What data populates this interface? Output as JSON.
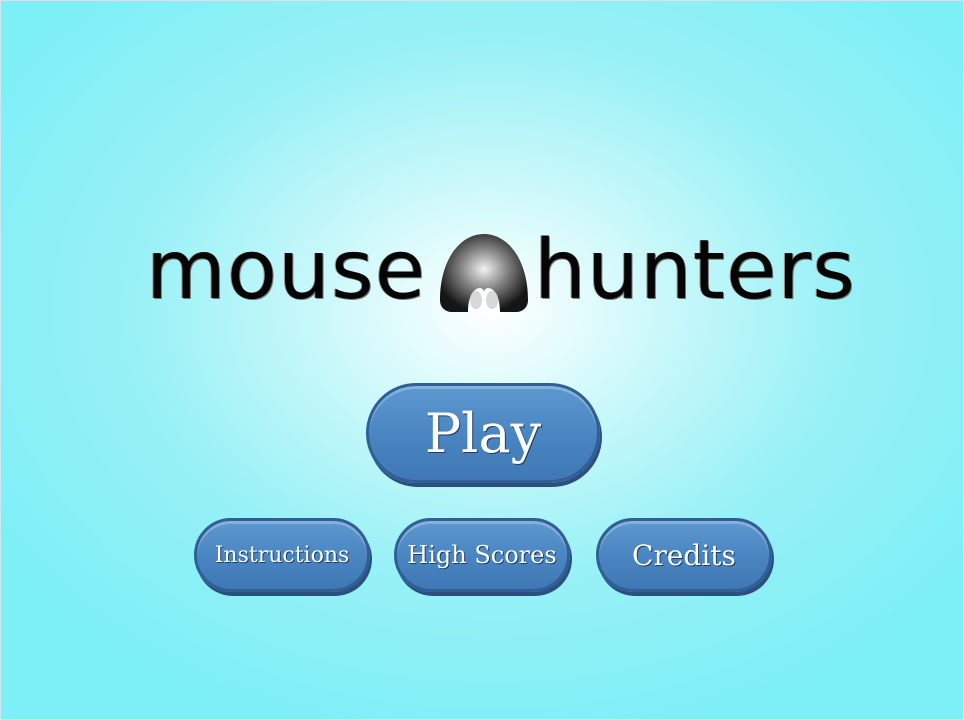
{
  "logo": {
    "left_word": "mouse",
    "right_word": "hunters",
    "icon": "mouse-head-icon"
  },
  "menu": {
    "play_label": "Play",
    "instructions_label": "Instructions",
    "high_scores_label": "High Scores",
    "credits_label": "Credits"
  },
  "colors": {
    "background_center": "#ffffff",
    "background_edge": "#7ceff7",
    "button_fill": "#4a86c2",
    "button_border": "#2f5f96",
    "button_text": "#ffffff",
    "logo_text": "#050505"
  }
}
